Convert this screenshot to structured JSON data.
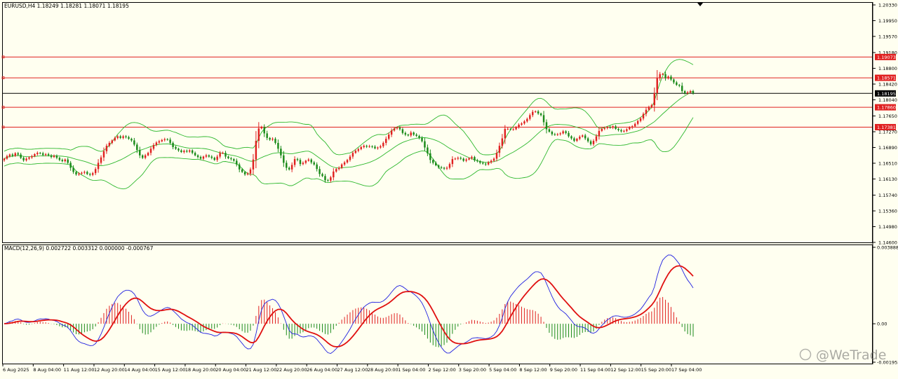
{
  "chart_data": {
    "type": "candlestick",
    "symbol_info": "EURUSD,H4  1.18249 1.18281 1.18071 1.18195",
    "price_axis": {
      "ylim": [
        1.146,
        1.2033
      ],
      "ticks": [
        "1.20330",
        "1.19950",
        "1.19570",
        "1.19180",
        "1.18800",
        "1.18420",
        "1.18040",
        "1.17650",
        "1.17270",
        "1.16890",
        "1.16510",
        "1.16130",
        "1.15740",
        "1.15360",
        "1.14980",
        "1.14600"
      ]
    },
    "horizontal_levels": [
      {
        "value": 1.19073,
        "label": "1.19073",
        "color": "#e02020"
      },
      {
        "value": 1.18571,
        "label": "1.18571",
        "color": "#e02020"
      },
      {
        "value": 1.1786,
        "label": "1.17860",
        "color": "#e02020"
      },
      {
        "value": 1.17381,
        "label": "1.17381",
        "color": "#e02020"
      }
    ],
    "current_price": {
      "value": 1.18195,
      "label": "1.18195",
      "color": "#000000"
    },
    "colors": {
      "up": "#e02020",
      "down": "#1a8a1a",
      "bands": "#2db82d",
      "macd_line": "#2020e0",
      "signal_line": "#e01010",
      "background": "#fffff0"
    },
    "candles_close": [
      1.1662,
      1.1668,
      1.1672,
      1.1669,
      1.1675,
      1.1672,
      1.1664,
      1.1658,
      1.1662,
      1.1665,
      1.1668,
      1.1673,
      1.1676,
      1.1675,
      1.1671,
      1.1673,
      1.167,
      1.1666,
      1.1669,
      1.1664,
      1.1659,
      1.1656,
      1.166,
      1.1652,
      1.164,
      1.163,
      1.1624,
      1.1626,
      1.1628,
      1.163,
      1.1625,
      1.1623,
      1.1627,
      1.1637,
      1.1652,
      1.1665,
      1.168,
      1.1693,
      1.17,
      1.1706,
      1.1712,
      1.1716,
      1.1712,
      1.1716,
      1.1714,
      1.171,
      1.1706,
      1.1696,
      1.1683,
      1.167,
      1.1664,
      1.167,
      1.1676,
      1.1686,
      1.1695,
      1.1701,
      1.1704,
      1.1707,
      1.1709,
      1.1708,
      1.17,
      1.169,
      1.1686,
      1.1682,
      1.1678,
      1.1681,
      1.1679,
      1.1682,
      1.1676,
      1.167,
      1.1666,
      1.1662,
      1.1667,
      1.167,
      1.1667,
      1.1664,
      1.1659,
      1.1667,
      1.1676,
      1.1676,
      1.1667,
      1.1663,
      1.1661,
      1.1657,
      1.1648,
      1.1636,
      1.163,
      1.1624,
      1.1626,
      1.1636,
      1.166,
      1.1705,
      1.1735,
      1.1738,
      1.1723,
      1.1712,
      1.1708,
      1.171,
      1.17,
      1.1686,
      1.167,
      1.1652,
      1.164,
      1.1636,
      1.1647,
      1.1661,
      1.1659,
      1.1649,
      1.1652,
      1.1657,
      1.166,
      1.1653,
      1.1648,
      1.1637,
      1.1625,
      1.162,
      1.161,
      1.1609,
      1.1617,
      1.1631,
      1.1637,
      1.164,
      1.1648,
      1.1653,
      1.1659,
      1.1667,
      1.1676,
      1.1681,
      1.1685,
      1.169,
      1.1693,
      1.1691,
      1.1692,
      1.1691,
      1.1687,
      1.1689,
      1.1692,
      1.17,
      1.171,
      1.172,
      1.173,
      1.1735,
      1.1737,
      1.1733,
      1.1724,
      1.172,
      1.1718,
      1.1725,
      1.172,
      1.1717,
      1.1712,
      1.1704,
      1.1689,
      1.1675,
      1.1659,
      1.1652,
      1.1646,
      1.1641,
      1.164,
      1.1638,
      1.164,
      1.1649,
      1.1661,
      1.1662,
      1.1664,
      1.1662,
      1.1657,
      1.166,
      1.1663,
      1.1666,
      1.1658,
      1.1656,
      1.1652,
      1.165,
      1.1648,
      1.1653,
      1.1657,
      1.1662,
      1.1676,
      1.1693,
      1.1711,
      1.1734,
      1.1734,
      1.1733,
      1.1733,
      1.1738,
      1.1744,
      1.1747,
      1.1752,
      1.1758,
      1.1767,
      1.1775,
      1.1776,
      1.1771,
      1.1767,
      1.175,
      1.1733,
      1.1727,
      1.1721,
      1.172,
      1.1721,
      1.1723,
      1.1728,
      1.1724,
      1.1716,
      1.1711,
      1.1705,
      1.171,
      1.1715,
      1.1718,
      1.1711,
      1.1704,
      1.1697,
      1.1705,
      1.1716,
      1.1729,
      1.1734,
      1.1736,
      1.1738,
      1.1737,
      1.174,
      1.1734,
      1.1731,
      1.1728,
      1.1729,
      1.1733,
      1.1737,
      1.174,
      1.1746,
      1.1753,
      1.1759,
      1.177,
      1.178,
      1.1787,
      1.1791,
      1.182,
      1.1856,
      1.1866,
      1.1866,
      1.1856,
      1.186,
      1.1853,
      1.1846,
      1.184,
      1.1838,
      1.1825,
      1.182,
      1.1822,
      1.1825,
      1.182
    ],
    "macd_info": "MACD(12,26,9) 0.002722 0.003312 0.000000 -0.000767",
    "macd_axis": {
      "ylim": [
        -0.001955,
        0.003888
      ],
      "ticks": [
        "0.003888",
        "0.00",
        "-0.001955"
      ]
    },
    "time_labels": [
      "6 Aug 2025",
      "8 Aug 04:00",
      "11 Aug 12:00",
      "12 Aug 20:00",
      "14 Aug 04:00",
      "15 Aug 12:00",
      "18 Aug 20:00",
      "20 Aug 04:00",
      "21 Aug 12:00",
      "22 Aug 20:00",
      "26 Aug 04:00",
      "27 Aug 12:00",
      "28 Aug 20:00",
      "1 Sep 04:00",
      "2 Sep 12:00",
      "3 Sep 20:00",
      "5 Sep 04:00",
      "8 Sep 12:00",
      "9 Sep 20:00",
      "11 Sep 04:00",
      "12 Sep 12:00",
      "15 Sep 20:00",
      "17 Sep 04:00"
    ],
    "bollinger_bands": {
      "period": 20
    },
    "watermark": "@WeTrade"
  }
}
